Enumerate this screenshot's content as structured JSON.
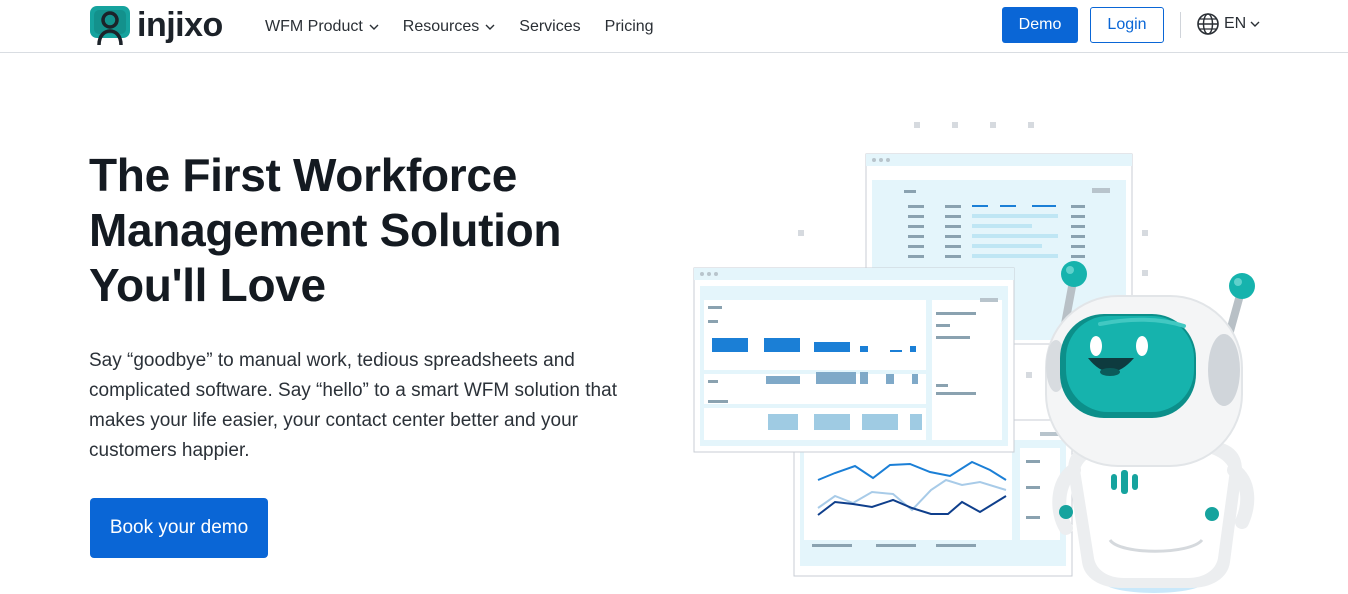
{
  "brand": {
    "name": "injixo",
    "color": "#0a66d6"
  },
  "nav": {
    "items": [
      {
        "label": "WFM Product",
        "dropdown": true
      },
      {
        "label": "Resources",
        "dropdown": true
      },
      {
        "label": "Services",
        "dropdown": false
      },
      {
        "label": "Pricing",
        "dropdown": false
      }
    ]
  },
  "header": {
    "demo_label": "Demo",
    "login_label": "Login",
    "language": "EN"
  },
  "hero": {
    "title_lines": [
      "The First Workforce",
      "Management Solution",
      "You'll Love"
    ],
    "text_lines": [
      "Say “goodbye” to manual work, tedious spreadsheets and",
      "complicated software. Say “hello” to a smart WFM solution that",
      "makes your life easier, your contact center better and your",
      "customers happier."
    ],
    "cta_label": "Book your demo"
  },
  "illustration": {
    "robot_color": "#16b3ad",
    "panel_color": "#e4f5fb"
  }
}
